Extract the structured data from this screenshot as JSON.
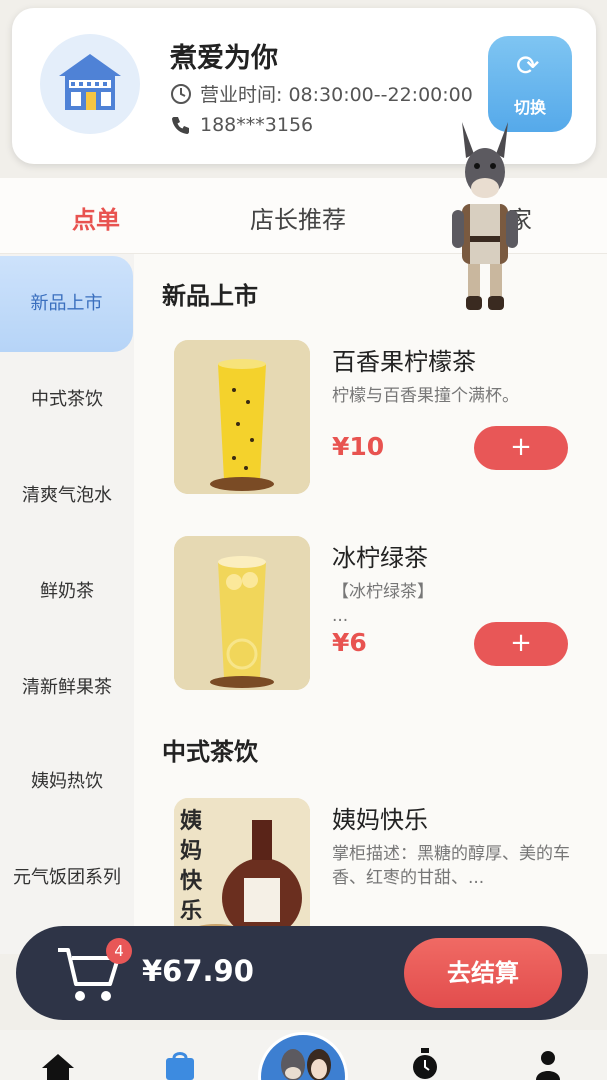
{
  "shop": {
    "name": "煮爱为你",
    "hours": "营业时间: 08:30:00--22:00:00",
    "phone": "188***3156",
    "switch_label": "切换"
  },
  "tabs": [
    {
      "label": "点单",
      "active": true
    },
    {
      "label": "店长推荐",
      "active": false
    },
    {
      "label": "家",
      "active": false
    }
  ],
  "sidebar": {
    "items": [
      {
        "label": "新品上市",
        "active": true
      },
      {
        "label": "中式茶饮"
      },
      {
        "label": "清爽气泡水"
      },
      {
        "label": "鲜奶茶"
      },
      {
        "label": "清新鲜果茶"
      },
      {
        "label": "姨妈热饮"
      },
      {
        "label": "元气饭团系列"
      }
    ]
  },
  "sections": [
    {
      "title": "新品上市",
      "products": [
        {
          "name": "百香果柠檬茶",
          "desc": "柠檬与百香果撞个满杯。",
          "price": "¥10",
          "add": "+"
        },
        {
          "name": "冰柠绿茶",
          "desc": "【冰柠绿茶】",
          "desc2": "...",
          "price": "¥6",
          "add": "+"
        }
      ]
    },
    {
      "title": "中式茶饮",
      "products": [
        {
          "name": "姨妈快乐",
          "desc": "掌柜描述：黑糖的醇厚、美的车香、红枣的甘甜、...",
          "img_text": "姨妈快乐"
        }
      ]
    }
  ],
  "cart": {
    "count": "4",
    "total": "¥67.90",
    "checkout_label": "去结算"
  },
  "colors": {
    "accent": "#e85350",
    "active_side": "#3a6fbe",
    "cart_bg": "#2e3447"
  },
  "icons": {
    "nav": [
      "home-icon",
      "bag-icon",
      "mascot-avatar",
      "clock-icon",
      "user-icon"
    ]
  }
}
